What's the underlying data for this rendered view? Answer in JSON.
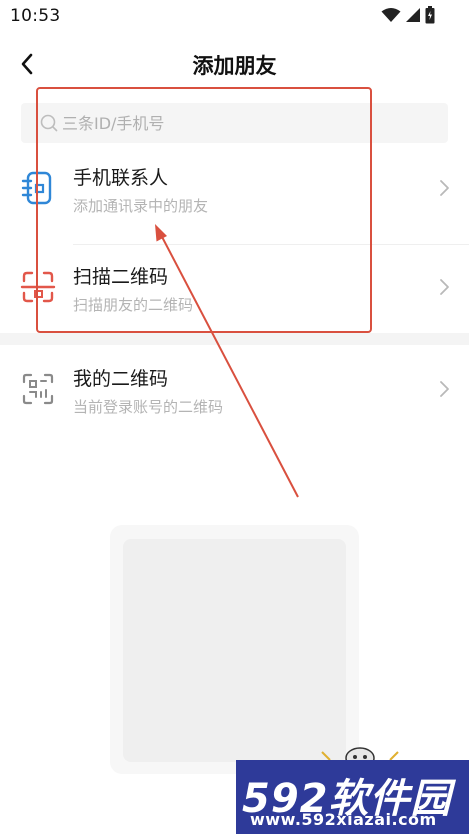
{
  "status_bar": {
    "time": "10:53",
    "icons": [
      "wifi-icon",
      "signal-icon",
      "battery-icon"
    ]
  },
  "header": {
    "title": "添加朋友",
    "back_icon": "back-arrow-icon"
  },
  "search": {
    "placeholder": "三条ID/手机号",
    "icon": "search-icon"
  },
  "items": [
    {
      "title": "手机联系人",
      "subtitle": "添加通讯录中的朋友",
      "icon": "phone-contacts-icon",
      "icon_color": "#2f87d7"
    },
    {
      "title": "扫描二维码",
      "subtitle": "扫描朋友的二维码",
      "icon": "scan-qr-icon",
      "icon_color": "#e2574a"
    },
    {
      "title": "我的二维码",
      "subtitle": "当前登录账号的二维码",
      "icon": "qr-code-icon",
      "icon_color": "#8a8a8a"
    }
  ],
  "annotation": {
    "color": "#d9503f"
  },
  "watermark": {
    "brand": "592软件园",
    "url": "www.592xiazai.com",
    "background": "#2e3a99"
  }
}
